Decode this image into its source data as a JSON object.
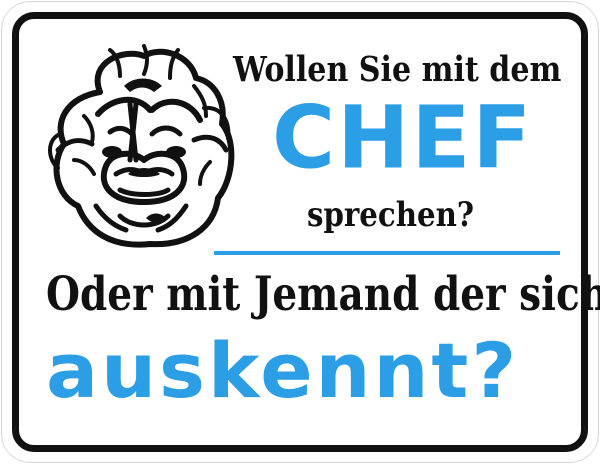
{
  "sign": {
    "line1": "Wollen Sie mit dem",
    "line2": "CHEF",
    "line3": "sprechen?",
    "line4": "Oder mit Jemand der sich",
    "line5": "auskennt?"
  },
  "mascot": {
    "icon": "grumpy-chef-face-icon"
  },
  "colors": {
    "border": "#111111",
    "text_dark": "#111111",
    "accent_blue": "#2b9ee5",
    "background": "#ffffff"
  }
}
